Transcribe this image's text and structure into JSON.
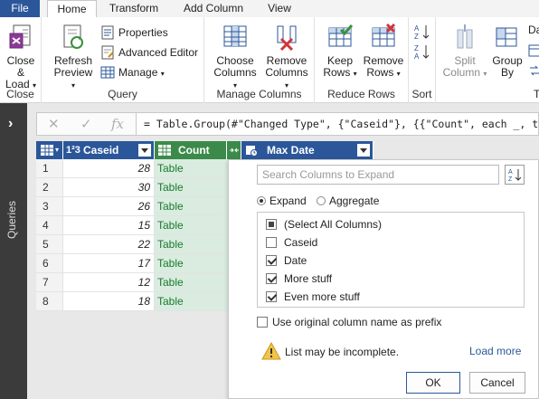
{
  "tabs": {
    "file": "File",
    "home": "Home",
    "transform": "Transform",
    "add_column": "Add Column",
    "view": "View"
  },
  "ribbon": {
    "close": {
      "button": "Close &\nLoad",
      "button_l1": "Close &",
      "button_l2": "Load",
      "group": "Close"
    },
    "query": {
      "refresh_l1": "Refresh",
      "refresh_l2": "Preview",
      "properties": "Properties",
      "advanced_editor": "Advanced Editor",
      "manage": "Manage",
      "group": "Query"
    },
    "manage_columns": {
      "choose_l1": "Choose",
      "choose_l2": "Columns",
      "remove_l1": "Remove",
      "remove_l2": "Columns",
      "group": "Manage Columns"
    },
    "reduce_rows": {
      "keep_l1": "Keep",
      "keep_l2": "Rows",
      "remove_l1": "Remove",
      "remove_l2": "Rows",
      "group": "Reduce Rows"
    },
    "sort": {
      "group": "Sort"
    },
    "transform": {
      "split_l1": "Split",
      "split_l2": "Column",
      "group_l1": "Group",
      "group_l2": "By",
      "cut_text": "Da"
    }
  },
  "queries_panel": {
    "label": "Queries"
  },
  "formula_bar": {
    "fx": "fx",
    "text": "= Table.Group(#\"Changed Type\", {\"Caseid\"}, {{\"Count\", each _, type"
  },
  "grid": {
    "headers": {
      "type_caseid": "1²3",
      "caseid": "Caseid",
      "count": "Count",
      "maxdate": "Max Date"
    },
    "rows": [
      {
        "n": "1",
        "caseid": "28",
        "count": "Table"
      },
      {
        "n": "2",
        "caseid": "30",
        "count": "Table"
      },
      {
        "n": "3",
        "caseid": "26",
        "count": "Table"
      },
      {
        "n": "4",
        "caseid": "15",
        "count": "Table"
      },
      {
        "n": "5",
        "caseid": "22",
        "count": "Table"
      },
      {
        "n": "6",
        "caseid": "17",
        "count": "Table"
      },
      {
        "n": "7",
        "caseid": "12",
        "count": "Table"
      },
      {
        "n": "8",
        "caseid": "18",
        "count": "Table"
      }
    ]
  },
  "popup": {
    "search_placeholder": "Search Columns to Expand",
    "expand": "Expand",
    "aggregate": "Aggregate",
    "columns": [
      {
        "label": "(Select All Columns)",
        "state": "partial"
      },
      {
        "label": "Caseid",
        "state": "unchecked"
      },
      {
        "label": "Date",
        "state": "checked"
      },
      {
        "label": "More stuff",
        "state": "checked"
      },
      {
        "label": "Even more stuff",
        "state": "checked"
      }
    ],
    "prefix_label": "Use original column name as prefix",
    "warning": "List may be incomplete.",
    "load_more": "Load more",
    "ok": "OK",
    "cancel": "Cancel"
  },
  "colors": {
    "accent": "#2b579a",
    "table_green_bg": "#d9ecdf",
    "table_green_text": "#1a7a2e"
  }
}
